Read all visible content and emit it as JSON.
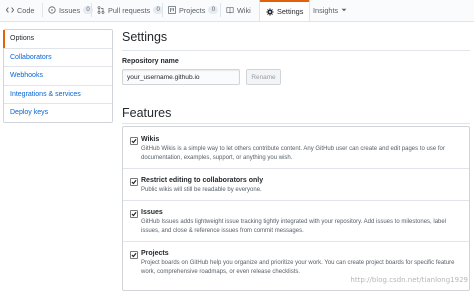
{
  "tabs": [
    {
      "label": "Code",
      "icon": "code-icon"
    },
    {
      "label": "Issues",
      "icon": "issue-icon",
      "count": "0"
    },
    {
      "label": "Pull requests",
      "icon": "pull-request-icon",
      "count": "0"
    },
    {
      "label": "Projects",
      "icon": "project-icon",
      "count": "0"
    },
    {
      "label": "Wiki",
      "icon": "book-icon"
    },
    {
      "label": "Settings",
      "icon": "gear-icon",
      "active": true
    },
    {
      "label": "Insights",
      "icon": "chevron-down-icon"
    }
  ],
  "sidebar": {
    "items": [
      {
        "label": "Options",
        "selected": true
      },
      {
        "label": "Collaborators"
      },
      {
        "label": "Webhooks"
      },
      {
        "label": "Integrations & services"
      },
      {
        "label": "Deploy keys"
      }
    ]
  },
  "main": {
    "title": "Settings",
    "repo_label": "Repository name",
    "repo_value": "your_username.github.io",
    "rename_label": "Rename",
    "features_title": "Features"
  },
  "features": [
    {
      "title": "Wikis",
      "checked": true,
      "desc": "GitHub Wikis is a simple way to let others contribute content. Any GitHub user can create and edit pages to use for documentation, examples, support, or anything you wish."
    },
    {
      "title": "Restrict editing to collaborators only",
      "checked": true,
      "desc": "Public wikis will still be readable by everyone."
    },
    {
      "title": "Issues",
      "checked": true,
      "desc": "GitHub Issues adds lightweight issue tracking tightly integrated with your repository. Add issues to milestones, label issues, and close & reference issues from commit messages."
    },
    {
      "title": "Projects",
      "checked": true,
      "desc": "Project boards on GitHub help you organize and prioritize your work. You can create project boards for specific feature work, comprehensive roadmaps, or even release checklists."
    }
  ],
  "watermark": "http://blog.csdn.net/tianlong1929",
  "colors": {
    "accent": "#e36209",
    "link": "#0366d6"
  }
}
